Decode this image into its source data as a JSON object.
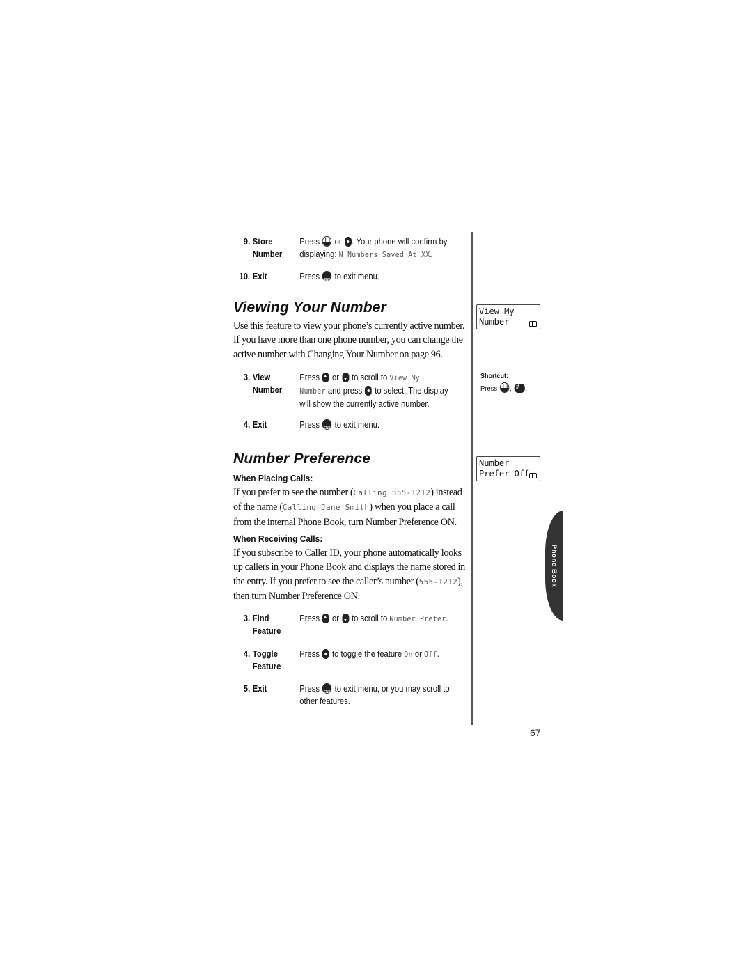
{
  "store_steps": [
    {
      "num": "9.",
      "label_line1": "Store",
      "label_line2": "Number",
      "text_a": "Press",
      "text_b": "or",
      "text_c": ". Your phone will confirm by",
      "text_d": "displaying: ",
      "display": "N Numbers Saved At XX",
      "text_e": "."
    },
    {
      "num": "10.",
      "label_line1": "Exit",
      "text_a": "Press",
      "text_c": "to exit menu."
    }
  ],
  "viewing": {
    "heading": "Viewing Your Number",
    "paragraph": "Use this feature to view your phone’s currently active number. If you have more than one phone number, you can change the active number with Changing Your Number on page 96.",
    "steps": [
      {
        "num": "3.",
        "label_line1": "View",
        "label_line2": "Number",
        "text_a": "Press",
        "text_b": "or",
        "text_c": "to scroll to",
        "display1": "View My",
        "display2": "Number",
        "text_d": "and press",
        "text_e": "to select. The display",
        "text_f": "will show the currently active number."
      },
      {
        "num": "4.",
        "label_line1": "Exit",
        "text_a": "Press",
        "text_c": "to exit menu."
      }
    ],
    "lcd": {
      "line1": "View My",
      "line2": "Number",
      "icon": "phone-book-icon"
    },
    "shortcut": {
      "title": "Shortcut:",
      "text_a": "Press",
      "text_b": ",",
      "text_c": "."
    }
  },
  "preference": {
    "heading": "Number Preference",
    "placing": {
      "subheading": "When Placing Calls:",
      "p1": "If you prefer to see the number (",
      "d1": "Calling 555-1212",
      "p2": ") instead of the name (",
      "d2": "Calling Jane Smith",
      "p3": ") when you place a call from the internal Phone Book, turn Number Preference ON."
    },
    "receiving": {
      "subheading": "When Receiving Calls:",
      "p1": "If you subscribe to Caller ID, your phone automatically looks up callers in your Phone Book and displays the name stored in the entry. If you prefer to see the caller’s number (",
      "d1": "555-1212",
      "p2": "), then turn Number Preference ON."
    },
    "steps": [
      {
        "num": "3.",
        "label_line1": "Find",
        "label_line2": "Feature",
        "text_a": "Press",
        "text_b": "or",
        "text_c": "to scroll to",
        "display": "Number Prefer",
        "text_d": "."
      },
      {
        "num": "4.",
        "label_line1": "Toggle",
        "label_line2": "Feature",
        "text_a": "Press",
        "text_c": "to toggle the feature",
        "display_on": "On",
        "text_or": "or",
        "display_off": "Off",
        "text_end": "."
      },
      {
        "num": "5.",
        "label_line1": "Exit",
        "text_a": "Press",
        "text_c": "to exit menu, or you may scroll to",
        "text_d": "other features."
      }
    ],
    "lcd": {
      "line1": "Number",
      "line2": "Prefer Off",
      "icon": "phone-book-icon"
    }
  },
  "side_tab": {
    "label": "Phone Book"
  },
  "page_number": "67"
}
